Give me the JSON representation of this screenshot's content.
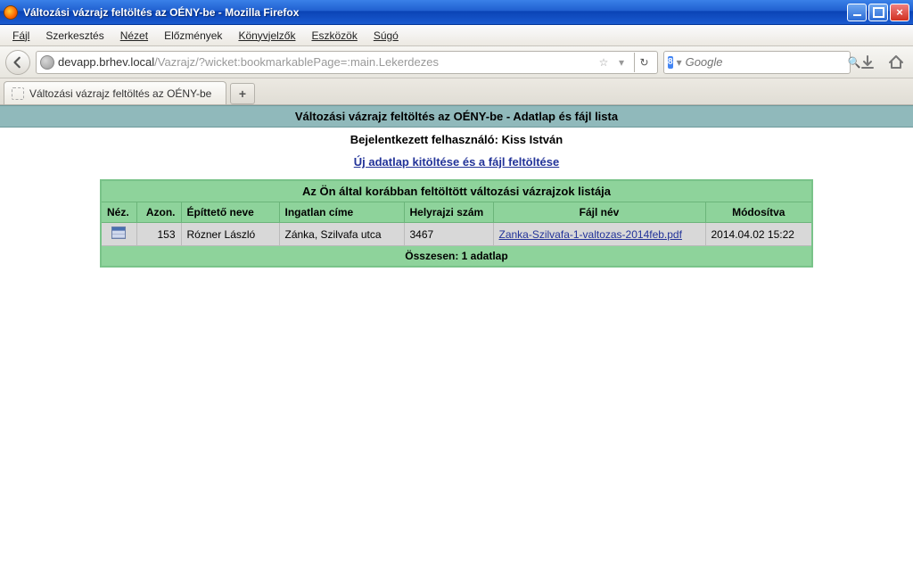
{
  "window": {
    "title": "Változási vázrajz feltöltés az OÉNY-be - Mozilla Firefox"
  },
  "menubar": {
    "file": "Fájl",
    "edit": "Szerkesztés",
    "view": "Nézet",
    "history": "Előzmények",
    "bookmarks": "Könyvjelzők",
    "tools": "Eszközök",
    "help": "Súgó"
  },
  "toolbar": {
    "url_host": "devapp.brhev.local",
    "url_path": "/Vazrajz/?wicket:bookmarkablePage=:main.Lekerdezes",
    "search_engine": "Google",
    "search_icon_label": "8"
  },
  "tabs": {
    "active": "Változási vázrajz feltöltés az OÉNY-be"
  },
  "page": {
    "header": "Változási vázrajz feltöltés az OÉNY-be - Adatlap és fájl lista",
    "user_prefix": "Bejelentkezett felhasználó: ",
    "user_name": "Kiss István",
    "new_link": "Új adatlap kitöltése és a fájl feltöltése",
    "table_title": "Az Ön által korábban feltöltött változási vázrajzok listája",
    "columns": {
      "view": "Néz.",
      "id": "Azon.",
      "builder": "Építtető neve",
      "address": "Ingatlan címe",
      "lotnum": "Helyrajzi szám",
      "filename": "Fájl név",
      "modified": "Módosítva"
    },
    "rows": [
      {
        "id": "153",
        "builder": "Rózner László",
        "address": "Zánka, Szilvafa utca",
        "lotnum": "3467",
        "filename": "Zanka-Szilvafa-1-valtozas-2014feb.pdf",
        "modified": "2014.04.02 15:22"
      }
    ],
    "summary": "Összesen: 1 adatlap"
  }
}
